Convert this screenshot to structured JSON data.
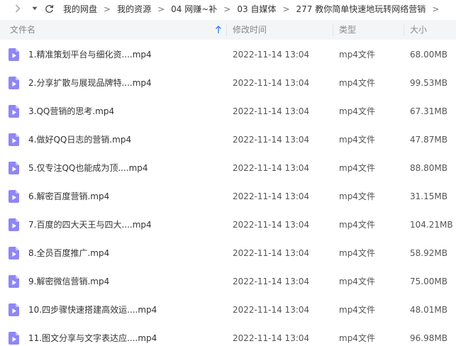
{
  "breadcrumb": {
    "items": [
      "我的网盘",
      "我的资源",
      "04 网赚~补",
      "03 自媒体",
      "277 教你简单快速地玩转网络营销"
    ],
    "separator": ">"
  },
  "header": {
    "name_label": "文件名",
    "date_label": "修改时间",
    "type_label": "类型",
    "size_label": "大小",
    "sort_direction": "ascending"
  },
  "colors": {
    "accent": "#2a7ef5",
    "video_icon": "#8f86f5",
    "header_bg": "#f4f5f7"
  },
  "files": [
    {
      "name": "1.精准策划平台与细化资....mp4",
      "date": "2022-11-14 13:04",
      "type": "mp4文件",
      "size": "68.00MB",
      "icon": "video-file-icon"
    },
    {
      "name": "2.分享扩散与展现品牌特....mp4",
      "date": "2022-11-14 13:04",
      "type": "mp4文件",
      "size": "99.53MB",
      "icon": "video-file-icon"
    },
    {
      "name": "3.QQ营销的思考.mp4",
      "date": "2022-11-14 13:04",
      "type": "mp4文件",
      "size": "67.31MB",
      "icon": "video-file-icon"
    },
    {
      "name": "4.做好QQ日志的营销.mp4",
      "date": "2022-11-14 13:04",
      "type": "mp4文件",
      "size": "47.87MB",
      "icon": "video-file-icon"
    },
    {
      "name": "5.仅专注QQ也能成为顶....mp4",
      "date": "2022-11-14 13:04",
      "type": "mp4文件",
      "size": "88.80MB",
      "icon": "video-file-icon"
    },
    {
      "name": "6.解密百度营销.mp4",
      "date": "2022-11-14 13:04",
      "type": "mp4文件",
      "size": "31.15MB",
      "icon": "video-file-icon"
    },
    {
      "name": "7.百度的四大天王与四大....mp4",
      "date": "2022-11-14 13:04",
      "type": "mp4文件",
      "size": "104.21MB",
      "icon": "video-file-icon"
    },
    {
      "name": "8.全员百度推广.mp4",
      "date": "2022-11-14 13:04",
      "type": "mp4文件",
      "size": "58.92MB",
      "icon": "video-file-icon"
    },
    {
      "name": "9.解密微信营销.mp4",
      "date": "2022-11-14 13:04",
      "type": "mp4文件",
      "size": "75.00MB",
      "icon": "video-file-icon"
    },
    {
      "name": "10.四步骤快速搭建高效运....mp4",
      "date": "2022-11-14 13:04",
      "type": "mp4文件",
      "size": "48.01MB",
      "icon": "video-file-icon"
    },
    {
      "name": "11.图文分享与文字表达应....mp4",
      "date": "2022-11-14 13:04",
      "type": "mp4文件",
      "size": "96.98MB",
      "icon": "video-file-icon"
    }
  ]
}
